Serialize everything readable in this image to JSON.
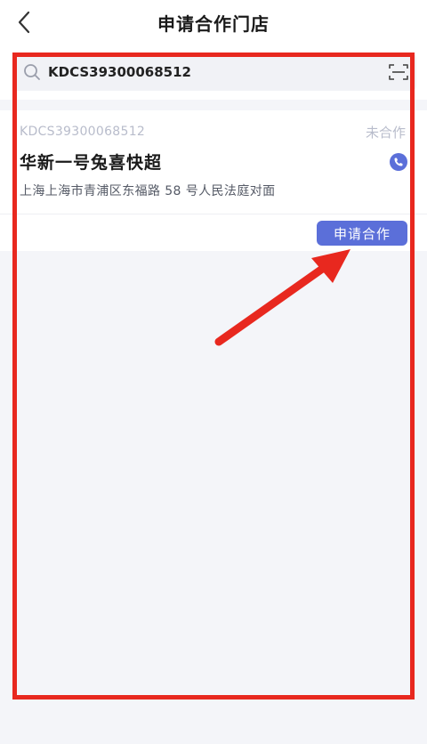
{
  "nav": {
    "title": "申请合作门店",
    "back_icon": "chevron-left-icon"
  },
  "search": {
    "value": "KDCS39300068512",
    "search_icon": "search-icon",
    "scan_icon": "scan-icon"
  },
  "store": {
    "code": "KDCS39300068512",
    "status": "未合作",
    "name": "华新一号兔喜快超",
    "address": "上海上海市青浦区东福路 58 号人民法庭对面",
    "phone_icon": "phone-icon",
    "apply_label": "申请合作"
  },
  "colors": {
    "accent": "#5b6fd9",
    "annotation": "#e8281f",
    "muted": "#b8bccb"
  }
}
